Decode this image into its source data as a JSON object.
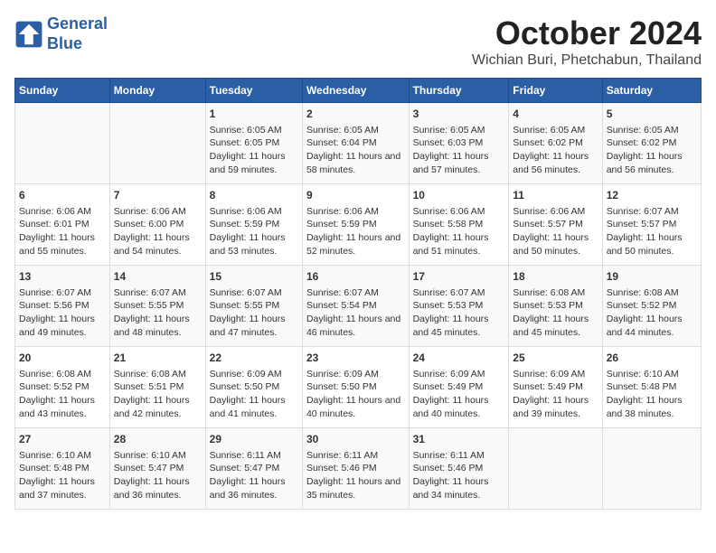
{
  "header": {
    "logo_line1": "General",
    "logo_line2": "Blue",
    "month": "October 2024",
    "location": "Wichian Buri, Phetchabun, Thailand"
  },
  "weekdays": [
    "Sunday",
    "Monday",
    "Tuesday",
    "Wednesday",
    "Thursday",
    "Friday",
    "Saturday"
  ],
  "weeks": [
    [
      {
        "day": "",
        "info": ""
      },
      {
        "day": "",
        "info": ""
      },
      {
        "day": "1",
        "info": "Sunrise: 6:05 AM\nSunset: 6:05 PM\nDaylight: 11 hours and 59 minutes."
      },
      {
        "day": "2",
        "info": "Sunrise: 6:05 AM\nSunset: 6:04 PM\nDaylight: 11 hours and 58 minutes."
      },
      {
        "day": "3",
        "info": "Sunrise: 6:05 AM\nSunset: 6:03 PM\nDaylight: 11 hours and 57 minutes."
      },
      {
        "day": "4",
        "info": "Sunrise: 6:05 AM\nSunset: 6:02 PM\nDaylight: 11 hours and 56 minutes."
      },
      {
        "day": "5",
        "info": "Sunrise: 6:05 AM\nSunset: 6:02 PM\nDaylight: 11 hours and 56 minutes."
      }
    ],
    [
      {
        "day": "6",
        "info": "Sunrise: 6:06 AM\nSunset: 6:01 PM\nDaylight: 11 hours and 55 minutes."
      },
      {
        "day": "7",
        "info": "Sunrise: 6:06 AM\nSunset: 6:00 PM\nDaylight: 11 hours and 54 minutes."
      },
      {
        "day": "8",
        "info": "Sunrise: 6:06 AM\nSunset: 5:59 PM\nDaylight: 11 hours and 53 minutes."
      },
      {
        "day": "9",
        "info": "Sunrise: 6:06 AM\nSunset: 5:59 PM\nDaylight: 11 hours and 52 minutes."
      },
      {
        "day": "10",
        "info": "Sunrise: 6:06 AM\nSunset: 5:58 PM\nDaylight: 11 hours and 51 minutes."
      },
      {
        "day": "11",
        "info": "Sunrise: 6:06 AM\nSunset: 5:57 PM\nDaylight: 11 hours and 50 minutes."
      },
      {
        "day": "12",
        "info": "Sunrise: 6:07 AM\nSunset: 5:57 PM\nDaylight: 11 hours and 50 minutes."
      }
    ],
    [
      {
        "day": "13",
        "info": "Sunrise: 6:07 AM\nSunset: 5:56 PM\nDaylight: 11 hours and 49 minutes."
      },
      {
        "day": "14",
        "info": "Sunrise: 6:07 AM\nSunset: 5:55 PM\nDaylight: 11 hours and 48 minutes."
      },
      {
        "day": "15",
        "info": "Sunrise: 6:07 AM\nSunset: 5:55 PM\nDaylight: 11 hours and 47 minutes."
      },
      {
        "day": "16",
        "info": "Sunrise: 6:07 AM\nSunset: 5:54 PM\nDaylight: 11 hours and 46 minutes."
      },
      {
        "day": "17",
        "info": "Sunrise: 6:07 AM\nSunset: 5:53 PM\nDaylight: 11 hours and 45 minutes."
      },
      {
        "day": "18",
        "info": "Sunrise: 6:08 AM\nSunset: 5:53 PM\nDaylight: 11 hours and 45 minutes."
      },
      {
        "day": "19",
        "info": "Sunrise: 6:08 AM\nSunset: 5:52 PM\nDaylight: 11 hours and 44 minutes."
      }
    ],
    [
      {
        "day": "20",
        "info": "Sunrise: 6:08 AM\nSunset: 5:52 PM\nDaylight: 11 hours and 43 minutes."
      },
      {
        "day": "21",
        "info": "Sunrise: 6:08 AM\nSunset: 5:51 PM\nDaylight: 11 hours and 42 minutes."
      },
      {
        "day": "22",
        "info": "Sunrise: 6:09 AM\nSunset: 5:50 PM\nDaylight: 11 hours and 41 minutes."
      },
      {
        "day": "23",
        "info": "Sunrise: 6:09 AM\nSunset: 5:50 PM\nDaylight: 11 hours and 40 minutes."
      },
      {
        "day": "24",
        "info": "Sunrise: 6:09 AM\nSunset: 5:49 PM\nDaylight: 11 hours and 40 minutes."
      },
      {
        "day": "25",
        "info": "Sunrise: 6:09 AM\nSunset: 5:49 PM\nDaylight: 11 hours and 39 minutes."
      },
      {
        "day": "26",
        "info": "Sunrise: 6:10 AM\nSunset: 5:48 PM\nDaylight: 11 hours and 38 minutes."
      }
    ],
    [
      {
        "day": "27",
        "info": "Sunrise: 6:10 AM\nSunset: 5:48 PM\nDaylight: 11 hours and 37 minutes."
      },
      {
        "day": "28",
        "info": "Sunrise: 6:10 AM\nSunset: 5:47 PM\nDaylight: 11 hours and 36 minutes."
      },
      {
        "day": "29",
        "info": "Sunrise: 6:11 AM\nSunset: 5:47 PM\nDaylight: 11 hours and 36 minutes."
      },
      {
        "day": "30",
        "info": "Sunrise: 6:11 AM\nSunset: 5:46 PM\nDaylight: 11 hours and 35 minutes."
      },
      {
        "day": "31",
        "info": "Sunrise: 6:11 AM\nSunset: 5:46 PM\nDaylight: 11 hours and 34 minutes."
      },
      {
        "day": "",
        "info": ""
      },
      {
        "day": "",
        "info": ""
      }
    ]
  ]
}
